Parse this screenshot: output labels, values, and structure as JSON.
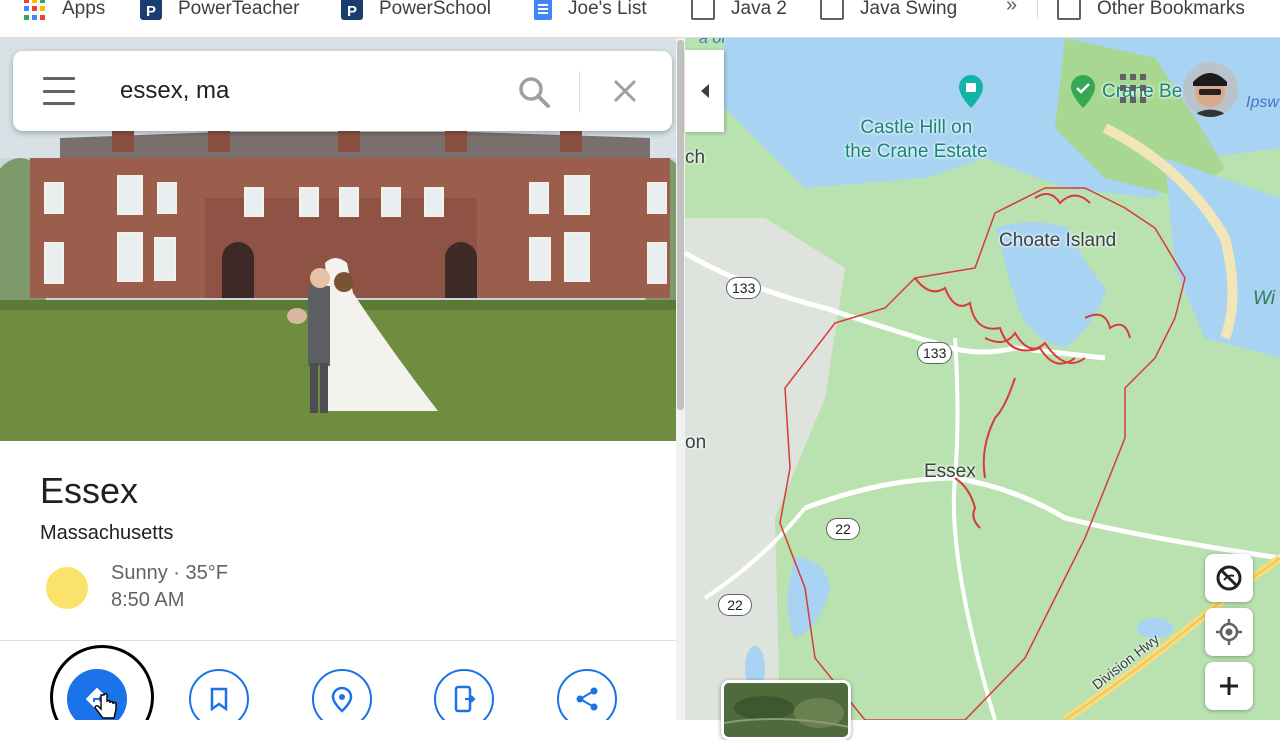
{
  "bookmarks": [
    {
      "label": "Apps",
      "icon": "apps-grid-icon"
    },
    {
      "label": "PowerTeacher",
      "icon": "powerschool-icon"
    },
    {
      "label": "PowerSchool",
      "icon": "powerschool-icon"
    },
    {
      "label": "Joe's List",
      "icon": "google-doc-icon"
    },
    {
      "label": "Java 2",
      "icon": "folder-icon"
    },
    {
      "label": "Java Swing",
      "icon": "folder-icon"
    },
    {
      "label": "Other Bookmarks",
      "icon": "folder-icon"
    }
  ],
  "bookmarks_more": "»",
  "search": {
    "value": "essex, ma"
  },
  "place": {
    "title": "Essex",
    "subtitle": "Massachusetts",
    "weather": "Sunny · 35°F",
    "time": "8:50 AM"
  },
  "map": {
    "labels": {
      "castle_hill_1": "Castle Hill on",
      "castle_hill_2": "the Crane Estate",
      "crane_beach": "Crane Be",
      "choate": "Choate Island",
      "essex": "Essex",
      "division_hwy": "Division Hwy",
      "ipsw": "Ipsw",
      "wi": "Wi",
      "ch": "ch",
      "on": "on",
      "top": "a of"
    },
    "shields": {
      "r133a": "133",
      "r133b": "133",
      "r22a": "22",
      "r22b": "22"
    }
  },
  "colors": {
    "accent": "#1a73e8",
    "boundary": "#d93a3a",
    "water": "#a9d3f2",
    "land": "#b9e2b0"
  }
}
